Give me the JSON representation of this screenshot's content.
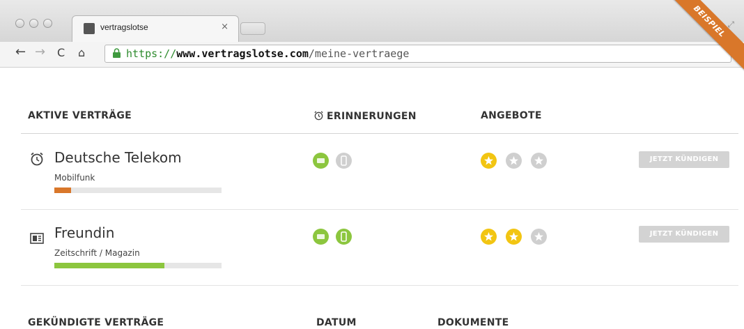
{
  "browser": {
    "tab_title": "vertragslotse",
    "tab_close": "×",
    "url_scheme": "https://",
    "url_domain": "www.vertragslotse.com",
    "url_path": "/meine-vertraege",
    "ribbon_label": "BEISPIEL",
    "ribbon_color": "#d9772a"
  },
  "active": {
    "header_contracts": "AKTIVE VERTRÄGE",
    "header_reminders": "ERINNERUNGEN",
    "header_offers": "ANGEBOTE",
    "rows": [
      {
        "icon": "alarm-clock-icon",
        "title": "Deutsche Telekom",
        "subtitle": "Mobilfunk",
        "progress": 0.1,
        "progress_color": "#d9772a",
        "reminder_email_active": true,
        "reminder_phone_active": false,
        "stars_active": 1,
        "cancel_label": "JETZT KÜNDIGEN"
      },
      {
        "icon": "newspaper-icon",
        "title": "Freundin",
        "subtitle": "Zeitschrift / Magazin",
        "progress": 0.66,
        "progress_color": "#8cc63e",
        "reminder_email_active": true,
        "reminder_phone_active": true,
        "stars_active": 2,
        "cancel_label": "JETZT KÜNDIGEN"
      }
    ]
  },
  "cancelled": {
    "header_contracts": "GEKÜNDIGTE VERTRÄGE",
    "header_date": "DATUM",
    "header_documents": "DOKUMENTE"
  },
  "colors": {
    "green": "#8cc63e",
    "gray": "#cfcfcf",
    "yellow": "#f2c512"
  }
}
